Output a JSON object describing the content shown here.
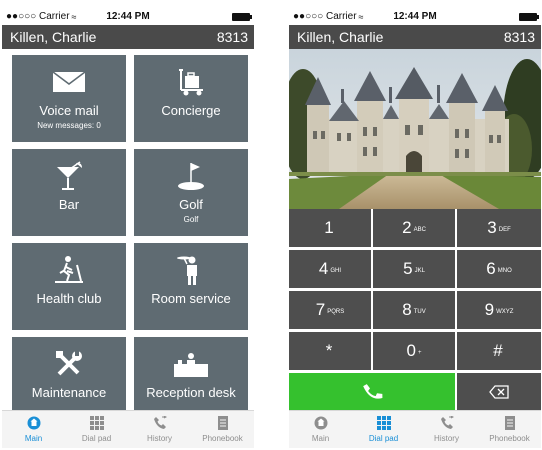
{
  "status": {
    "carrier": "●●○○○ Carrier",
    "time": "12:44 PM"
  },
  "header": {
    "name": "Killen, Charlie",
    "room": "8313"
  },
  "tiles": [
    {
      "label": "Voice mail",
      "sub": "New messages: 0",
      "icon": "envelope-icon"
    },
    {
      "label": "Concierge",
      "sub": "",
      "icon": "luggage-cart-icon"
    },
    {
      "label": "Bar",
      "sub": "",
      "icon": "cocktail-icon"
    },
    {
      "label": "Golf",
      "sub": "Golf",
      "icon": "golf-icon"
    },
    {
      "label": "Health club",
      "sub": "",
      "icon": "treadmill-icon"
    },
    {
      "label": "Room service",
      "sub": "",
      "icon": "waiter-icon"
    },
    {
      "label": "Maintenance",
      "sub": "",
      "icon": "tools-icon"
    },
    {
      "label": "Reception desk",
      "sub": "",
      "icon": "reception-bell-icon"
    }
  ],
  "tabs": [
    {
      "label": "Main",
      "icon": "home-icon"
    },
    {
      "label": "Dial pad",
      "icon": "dialpad-icon"
    },
    {
      "label": "History",
      "icon": "phone-history-icon"
    },
    {
      "label": "Phonebook",
      "icon": "phonebook-icon"
    }
  ],
  "keys": [
    {
      "digit": "1",
      "letters": ""
    },
    {
      "digit": "2",
      "letters": "ABC"
    },
    {
      "digit": "3",
      "letters": "DEF"
    },
    {
      "digit": "4",
      "letters": "GHI"
    },
    {
      "digit": "5",
      "letters": "JKL"
    },
    {
      "digit": "6",
      "letters": "MNO"
    },
    {
      "digit": "7",
      "letters": "PQRS"
    },
    {
      "digit": "8",
      "letters": "TUV"
    },
    {
      "digit": "9",
      "letters": "WXYZ"
    },
    {
      "digit": "*",
      "letters": ""
    },
    {
      "digit": "0",
      "letters": "+"
    },
    {
      "digit": "#",
      "letters": ""
    }
  ],
  "colors": {
    "tile": "#5f6b72",
    "key": "#4e4e4e",
    "call": "#35c12e",
    "active_tab": "#1a8fd6",
    "header": "#4a4a4a"
  }
}
